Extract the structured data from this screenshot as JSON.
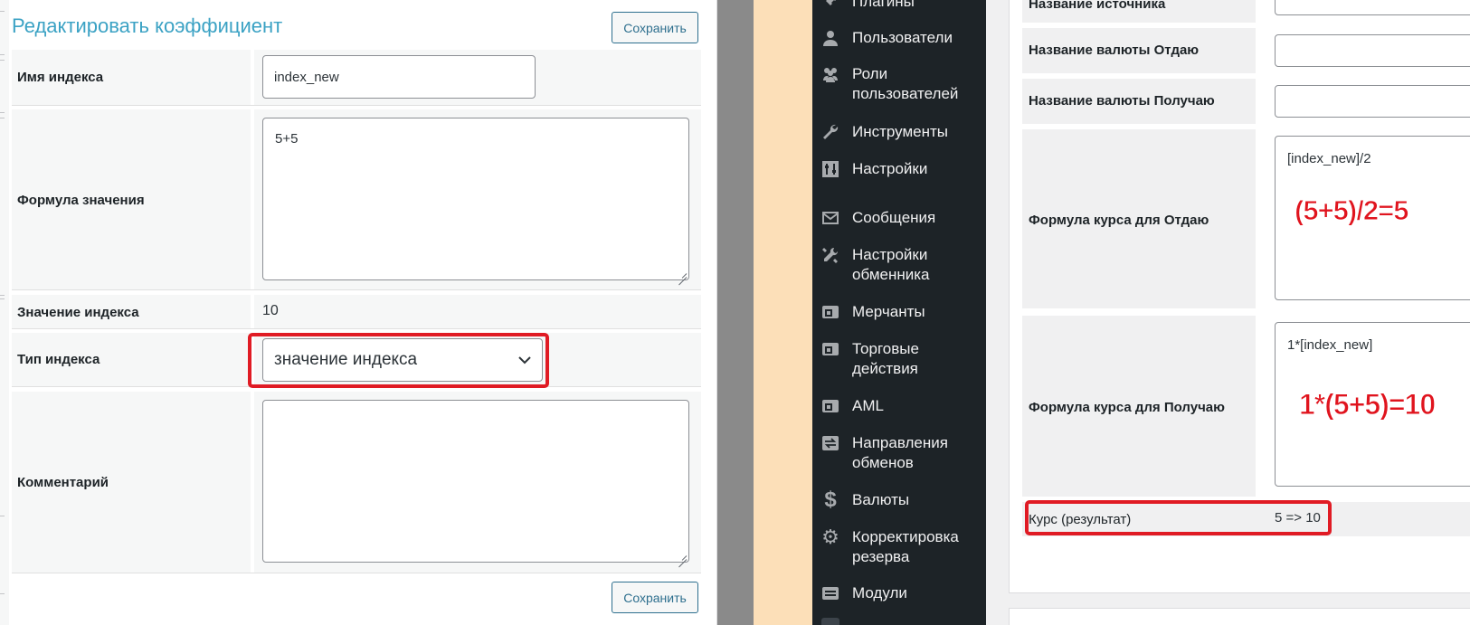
{
  "left": {
    "title": "Редактировать коэффициент",
    "save_label": "Сохранить",
    "fields": {
      "index_name_label": "Имя индекса",
      "index_name_value": "index_new",
      "formula_label": "Формула значения",
      "formula_value": "5+5",
      "index_value_label": "Значение индекса",
      "index_value": "10",
      "index_type_label": "Тип индекса",
      "index_type_selected": "значение индекса",
      "comment_label": "Комментарий",
      "comment_value": ""
    }
  },
  "sidebar": {
    "items": [
      {
        "label": "Плагины",
        "icon": "plugins-icon"
      },
      {
        "label": "Пользователи",
        "icon": "user-icon"
      },
      {
        "label": "Роли пользователей",
        "icon": "users-group-icon"
      },
      {
        "label": "Инструменты",
        "icon": "wrench-icon"
      },
      {
        "label": "Настройки",
        "icon": "settings-sliders-icon"
      },
      {
        "label": "Сообщения",
        "icon": "envelope-icon"
      },
      {
        "label": "Настройки обменника",
        "icon": "tools-icon"
      },
      {
        "label": "Мерчанты",
        "icon": "merchant-icon"
      },
      {
        "label": "Торговые действия",
        "icon": "trade-icon"
      },
      {
        "label": "AML",
        "icon": "aml-icon"
      },
      {
        "label": "Направления обменов",
        "icon": "directions-icon"
      },
      {
        "label": "Валюты",
        "icon": "dollar-icon"
      },
      {
        "label": "Корректировка резерва",
        "icon": "gear-icon"
      },
      {
        "label": "Модули",
        "icon": "modules-icon"
      }
    ]
  },
  "right": {
    "source_name_label": "Название источника",
    "give_currency_label": "Название валюты Отдаю",
    "get_currency_label": "Название валюты Получаю",
    "give_formula_label": "Формула курса для Отдаю",
    "give_formula_value": "[index_new]/2",
    "give_annotation": "(5+5)/2=5",
    "get_formula_label": "Формула курса для Получаю",
    "get_formula_value": "1*[index_new]",
    "get_annotation": "1*(5+5)=10",
    "rate_label": "Курс (результат)",
    "rate_value": "5 => 10"
  },
  "colors": {
    "title": "#3ba2c4",
    "annotation_red": "#e01b24",
    "sidebar_bg": "#1d2327",
    "peach": "#fcdfb8"
  }
}
